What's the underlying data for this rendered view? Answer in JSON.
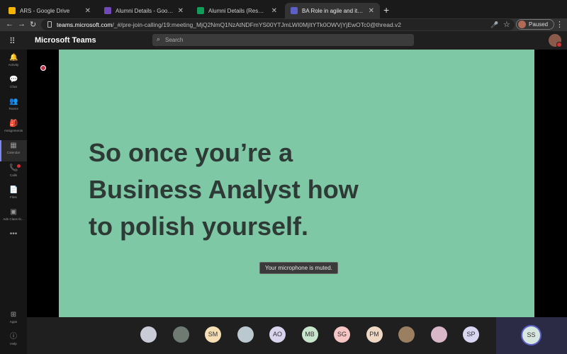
{
  "browser": {
    "tabs": [
      {
        "title": "ARS - Google Drive",
        "favicon_color": "#f4b400",
        "active": false
      },
      {
        "title": "Alumni Details - Google Forms",
        "favicon_color": "#7248b9",
        "active": false
      },
      {
        "title": "Alumni Details (Responses) - G",
        "favicon_color": "#0f9d58",
        "active": false
      },
      {
        "title": "BA Role in agile and its sco",
        "favicon_color": "#5b5fc7",
        "active": true
      }
    ],
    "new_tab_icon": "+",
    "url_host": "teams.microsoft.com",
    "url_path": "/_#/pre-join-calling/19:meeting_MjQ2NmQ1NzAtNDFmYS00YTJmLWI0MjItYTk0OWVjYjEwOTc0@thread.v2",
    "profile_status": "Paused"
  },
  "teams": {
    "app_name": "Microsoft Teams",
    "search_placeholder": "Search",
    "rail": [
      {
        "label": "Activity",
        "icon": "bell-icon",
        "glyph": "🔔"
      },
      {
        "label": "Chat",
        "icon": "chat-icon",
        "glyph": "💬"
      },
      {
        "label": "Teams",
        "icon": "teams-icon",
        "glyph": "👥"
      },
      {
        "label": "Assignments",
        "icon": "assignments-icon",
        "glyph": "🎒"
      },
      {
        "label": "Calendar",
        "icon": "calendar-icon",
        "glyph": "▦"
      },
      {
        "label": "Calls",
        "icon": "phone-icon",
        "glyph": "📞"
      },
      {
        "label": "Files",
        "icon": "files-icon",
        "glyph": "📄"
      },
      {
        "label": "Ads Class Ib...",
        "icon": "app-icon",
        "glyph": "▣"
      },
      {
        "label": "",
        "icon": "more-icon",
        "glyph": "•••"
      },
      {
        "label": "Apps",
        "icon": "apps-icon",
        "glyph": "⊞"
      },
      {
        "label": "Help",
        "icon": "help-icon",
        "glyph": "ⓘ"
      }
    ]
  },
  "slide": {
    "text": "So once you’re a\nBusiness Analyst how\nto polish yourself.",
    "background": "#7ec8a6"
  },
  "notification": "Your microphone is muted.",
  "participants": [
    {
      "initials": "",
      "color": "#c9cbd6"
    },
    {
      "initials": "",
      "color": "#6f7a72"
    },
    {
      "initials": "SM",
      "color": "#f7dfb4"
    },
    {
      "initials": "",
      "color": "#b9c9cf"
    },
    {
      "initials": "AO",
      "color": "#d9d3ee"
    },
    {
      "initials": "MB",
      "color": "#c7e6cd"
    },
    {
      "initials": "SG",
      "color": "#f5c6c3"
    },
    {
      "initials": "PM",
      "color": "#eed8c4"
    },
    {
      "initials": "",
      "color": "#9a8060"
    },
    {
      "initials": "",
      "color": "#d8b7c9"
    },
    {
      "initials": "SP",
      "color": "#d9d6f2"
    }
  ],
  "self_view": {
    "initials": "SS"
  }
}
